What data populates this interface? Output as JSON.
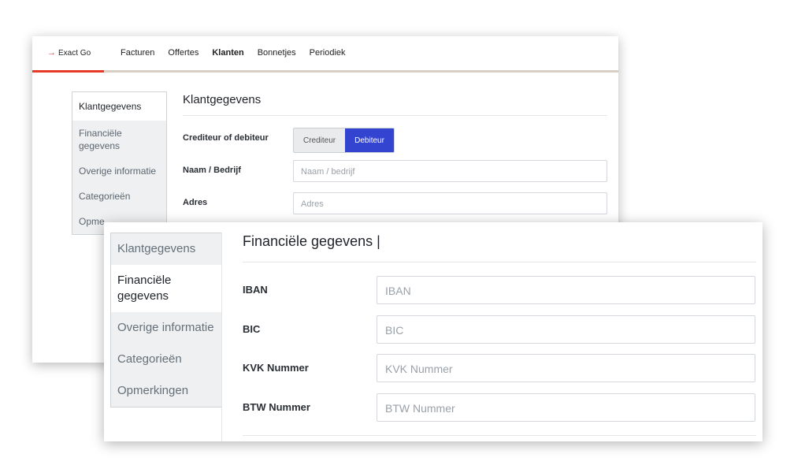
{
  "app": {
    "logo_text": "Exact Go",
    "logo_mark": "→"
  },
  "nav": {
    "items": [
      "Facturen",
      "Offertes",
      "Klanten",
      "Bonnetjes",
      "Periodiek"
    ],
    "active": "Klanten"
  },
  "back": {
    "sidebar": [
      "Klantgegevens",
      "Financiële gegevens",
      "Overige informatie",
      "Categorieën",
      "Opme"
    ],
    "title": "Klantgegevens",
    "fields": {
      "type_label": "Crediteur of debiteur",
      "crediteur": "Crediteur",
      "debiteur": "Debiteur",
      "name_label": "Naam / Bedrijf",
      "name_placeholder": "Naam / bedrijf",
      "address_label": "Adres",
      "address_placeholder": "Adres"
    }
  },
  "front": {
    "sidebar": [
      "Klantgegevens",
      "Financiële gegevens",
      "Overige informatie",
      "Categorieën",
      "Opmerkingen"
    ],
    "title": "Financiële gegevens |",
    "fields": [
      {
        "label": "IBAN",
        "placeholder": "IBAN"
      },
      {
        "label": "BIC",
        "placeholder": "BIC"
      },
      {
        "label": "KVK Nummer",
        "placeholder": "KVK Nummer"
      },
      {
        "label": "BTW Nummer",
        "placeholder": "BTW Nummer"
      }
    ]
  },
  "colors": {
    "brand": "#e53a26",
    "accent": "#3344d1"
  }
}
